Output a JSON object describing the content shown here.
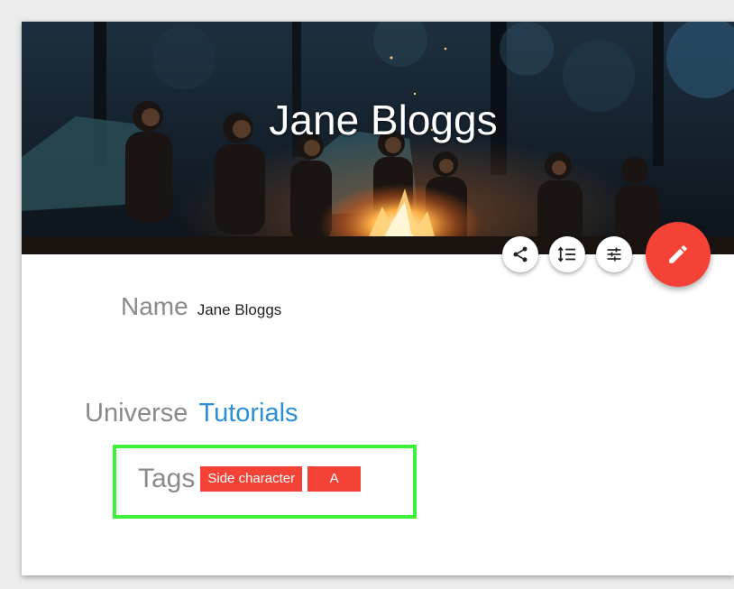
{
  "page": {
    "title": "Jane Bloggs"
  },
  "actions": {
    "share_icon": "share-icon",
    "sort_icon": "sort-list-icon",
    "tune_icon": "tune-icon",
    "edit_icon": "edit-pencil-icon"
  },
  "fields": {
    "name": {
      "label": "Name",
      "value": "Jane Bloggs"
    },
    "universe": {
      "label": "Universe",
      "value": "Tutorials"
    },
    "tags": {
      "label": "Tags",
      "items": [
        "Side character",
        "A"
      ]
    }
  },
  "colors": {
    "accent": "#f44336",
    "link": "#2b8fd6",
    "highlight": "#3df03a",
    "label": "#8a8a8a"
  }
}
